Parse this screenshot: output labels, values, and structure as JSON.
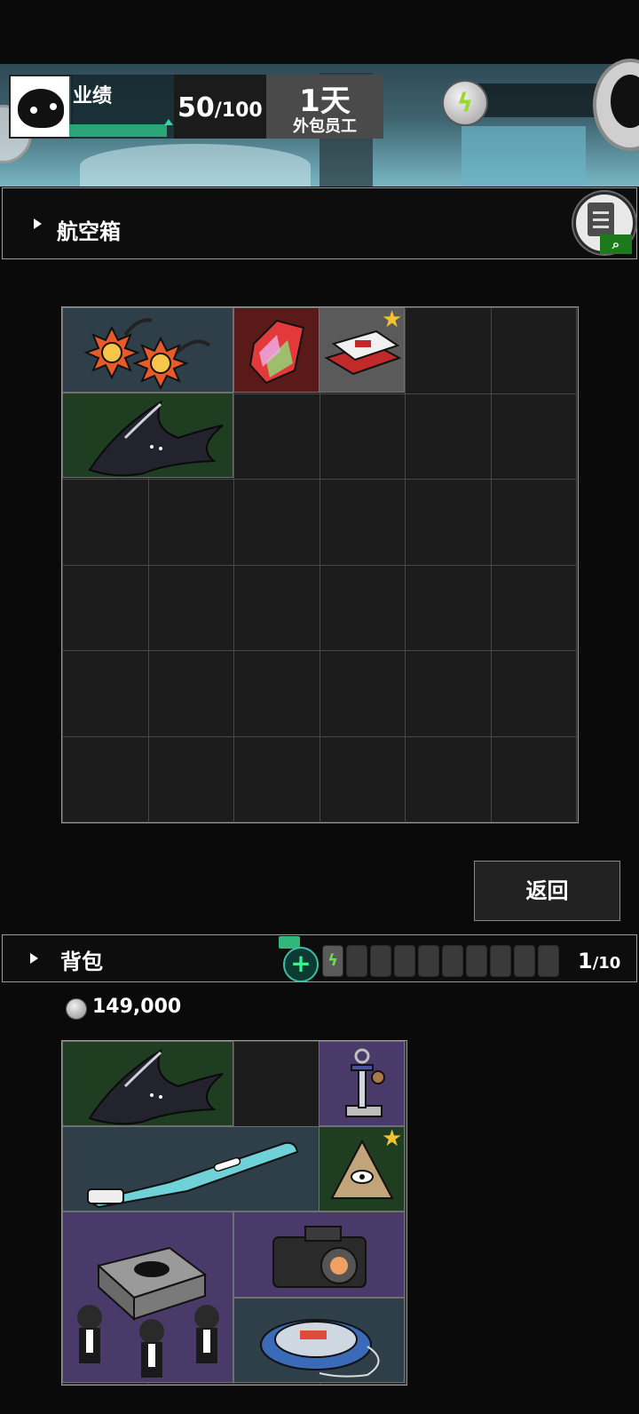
{
  "hud": {
    "performance_label": "业绩",
    "performance_value": "50",
    "performance_max": "/100",
    "performance_progress": 0.5,
    "day_number": "1天",
    "role": "外包员工",
    "energy_count": "0"
  },
  "case": {
    "title": "航空箱",
    "clipboard_search_icon": "search-icon",
    "items": [
      {
        "name": "twin-sun-charm",
        "color": "#2e3f4a"
      },
      {
        "name": "rainbow-crystal",
        "color": "#5a1a1a"
      },
      {
        "name": "cigarette-pack",
        "color": "#5a5a5a",
        "starred": true
      },
      {
        "name": "shadow-cloak",
        "color": "#1f3d21"
      }
    ]
  },
  "return_button": "返回",
  "bag": {
    "title": "背包",
    "battery_filled": 1,
    "battery_total": 10,
    "count_current": "1",
    "count_max": "/10",
    "money": "149,000",
    "items": [
      {
        "name": "shadow-cloak",
        "color": "#1f3d21"
      },
      {
        "name": "sword-keychain",
        "color": "#4a3a6a"
      },
      {
        "name": "electric-toothbrush",
        "color": "#2e3f4a"
      },
      {
        "name": "pyramid-eye",
        "color": "#1f3d21",
        "starred": true
      },
      {
        "name": "coffin-dance-speaker",
        "color": "#4a3a6a"
      },
      {
        "name": "camera",
        "color": "#4a3a6a"
      },
      {
        "name": "portable-cd-player",
        "color": "#2e3f4a"
      }
    ]
  }
}
